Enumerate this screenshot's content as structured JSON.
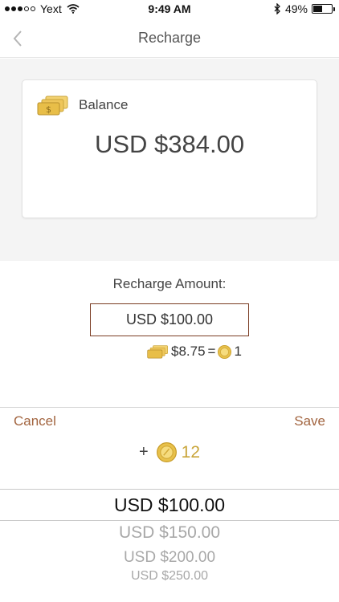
{
  "status": {
    "carrier": "Yext",
    "time": "9:49 AM",
    "battery": "49%",
    "battery_level": 0.49,
    "signal_bars": 3,
    "signal_total": 5
  },
  "nav": {
    "title": "Recharge",
    "back_icon": "chevron-left-icon"
  },
  "balance": {
    "label": "Balance",
    "amount": "USD $384.00",
    "icon": "cash-icon"
  },
  "recharge": {
    "label": "Recharge Amount:",
    "amount": "USD $100.00",
    "rate_price": "$8.75",
    "rate_equals": "=",
    "rate_coins": "1"
  },
  "toolbar": {
    "cancel_label": "Cancel",
    "save_label": "Save"
  },
  "bonus": {
    "plus": "+",
    "coins": "12"
  },
  "picker": {
    "selected": "USD $100.00",
    "options": [
      "USD $150.00",
      "USD $200.00",
      "USD $250.00"
    ]
  },
  "colors": {
    "accent": "#a2643f",
    "box_border": "#7a3b22",
    "gold": "#e8c14a",
    "gold_text": "#c9a53a"
  }
}
